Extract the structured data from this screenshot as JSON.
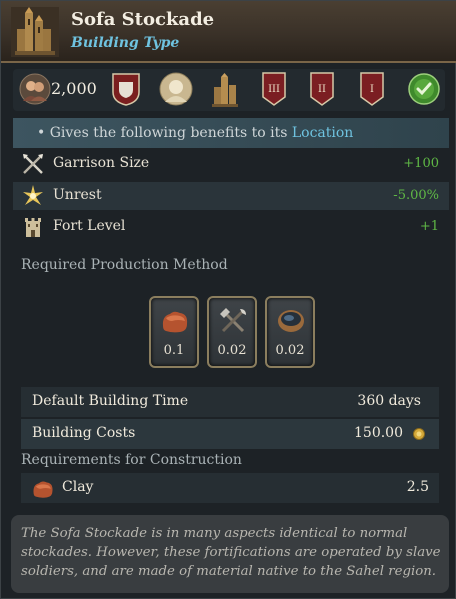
{
  "header": {
    "title": "Sofa Stockade",
    "subtitle": "Building Type",
    "icon": "castle-tower-icon"
  },
  "icon_row": {
    "population": "2,000",
    "icons": [
      "population-icon",
      "shield-crest-icon",
      "culture-portrait-icon",
      "castle-icon",
      "tier-3-banner-icon",
      "tier-2-banner-icon",
      "tier-1-banner-icon",
      "check-badge-icon"
    ],
    "banners": [
      "III",
      "II",
      "I"
    ]
  },
  "benefits": {
    "intro": "• Gives the following benefits to its ",
    "location_link": "Location",
    "items": [
      {
        "label": "Garrison Size",
        "value": "+100",
        "icon": "crossed-weapons-icon"
      },
      {
        "label": "Unrest",
        "value": "-5.00%",
        "icon": "unrest-burst-icon"
      },
      {
        "label": "Fort Level",
        "value": "+1",
        "icon": "fort-tower-icon"
      }
    ]
  },
  "production": {
    "label": "Required Production Method",
    "items": [
      {
        "value": "0.1",
        "icon": "clay-icon"
      },
      {
        "value": "0.02",
        "icon": "tools-icon"
      },
      {
        "value": "0.02",
        "icon": "pottery-bowl-icon"
      }
    ]
  },
  "building": {
    "time_label": "Default Building Time",
    "time_value": "360 days",
    "cost_label": "Building Costs",
    "cost_value": "150.00"
  },
  "requirements": {
    "label": "Requirements for Construction",
    "items": [
      {
        "label": "Clay",
        "value": "2.5",
        "icon": "clay-icon"
      }
    ]
  },
  "description": "The Sofa Stockade is in many aspects identical to normal stockades. However, these fortifications are operated by slave soldiers, and are made of material native to the Sahel region.",
  "colors": {
    "accent_blue": "#6fc3e0",
    "positive_green": "#5fb845",
    "gold": "#d4a93a"
  }
}
